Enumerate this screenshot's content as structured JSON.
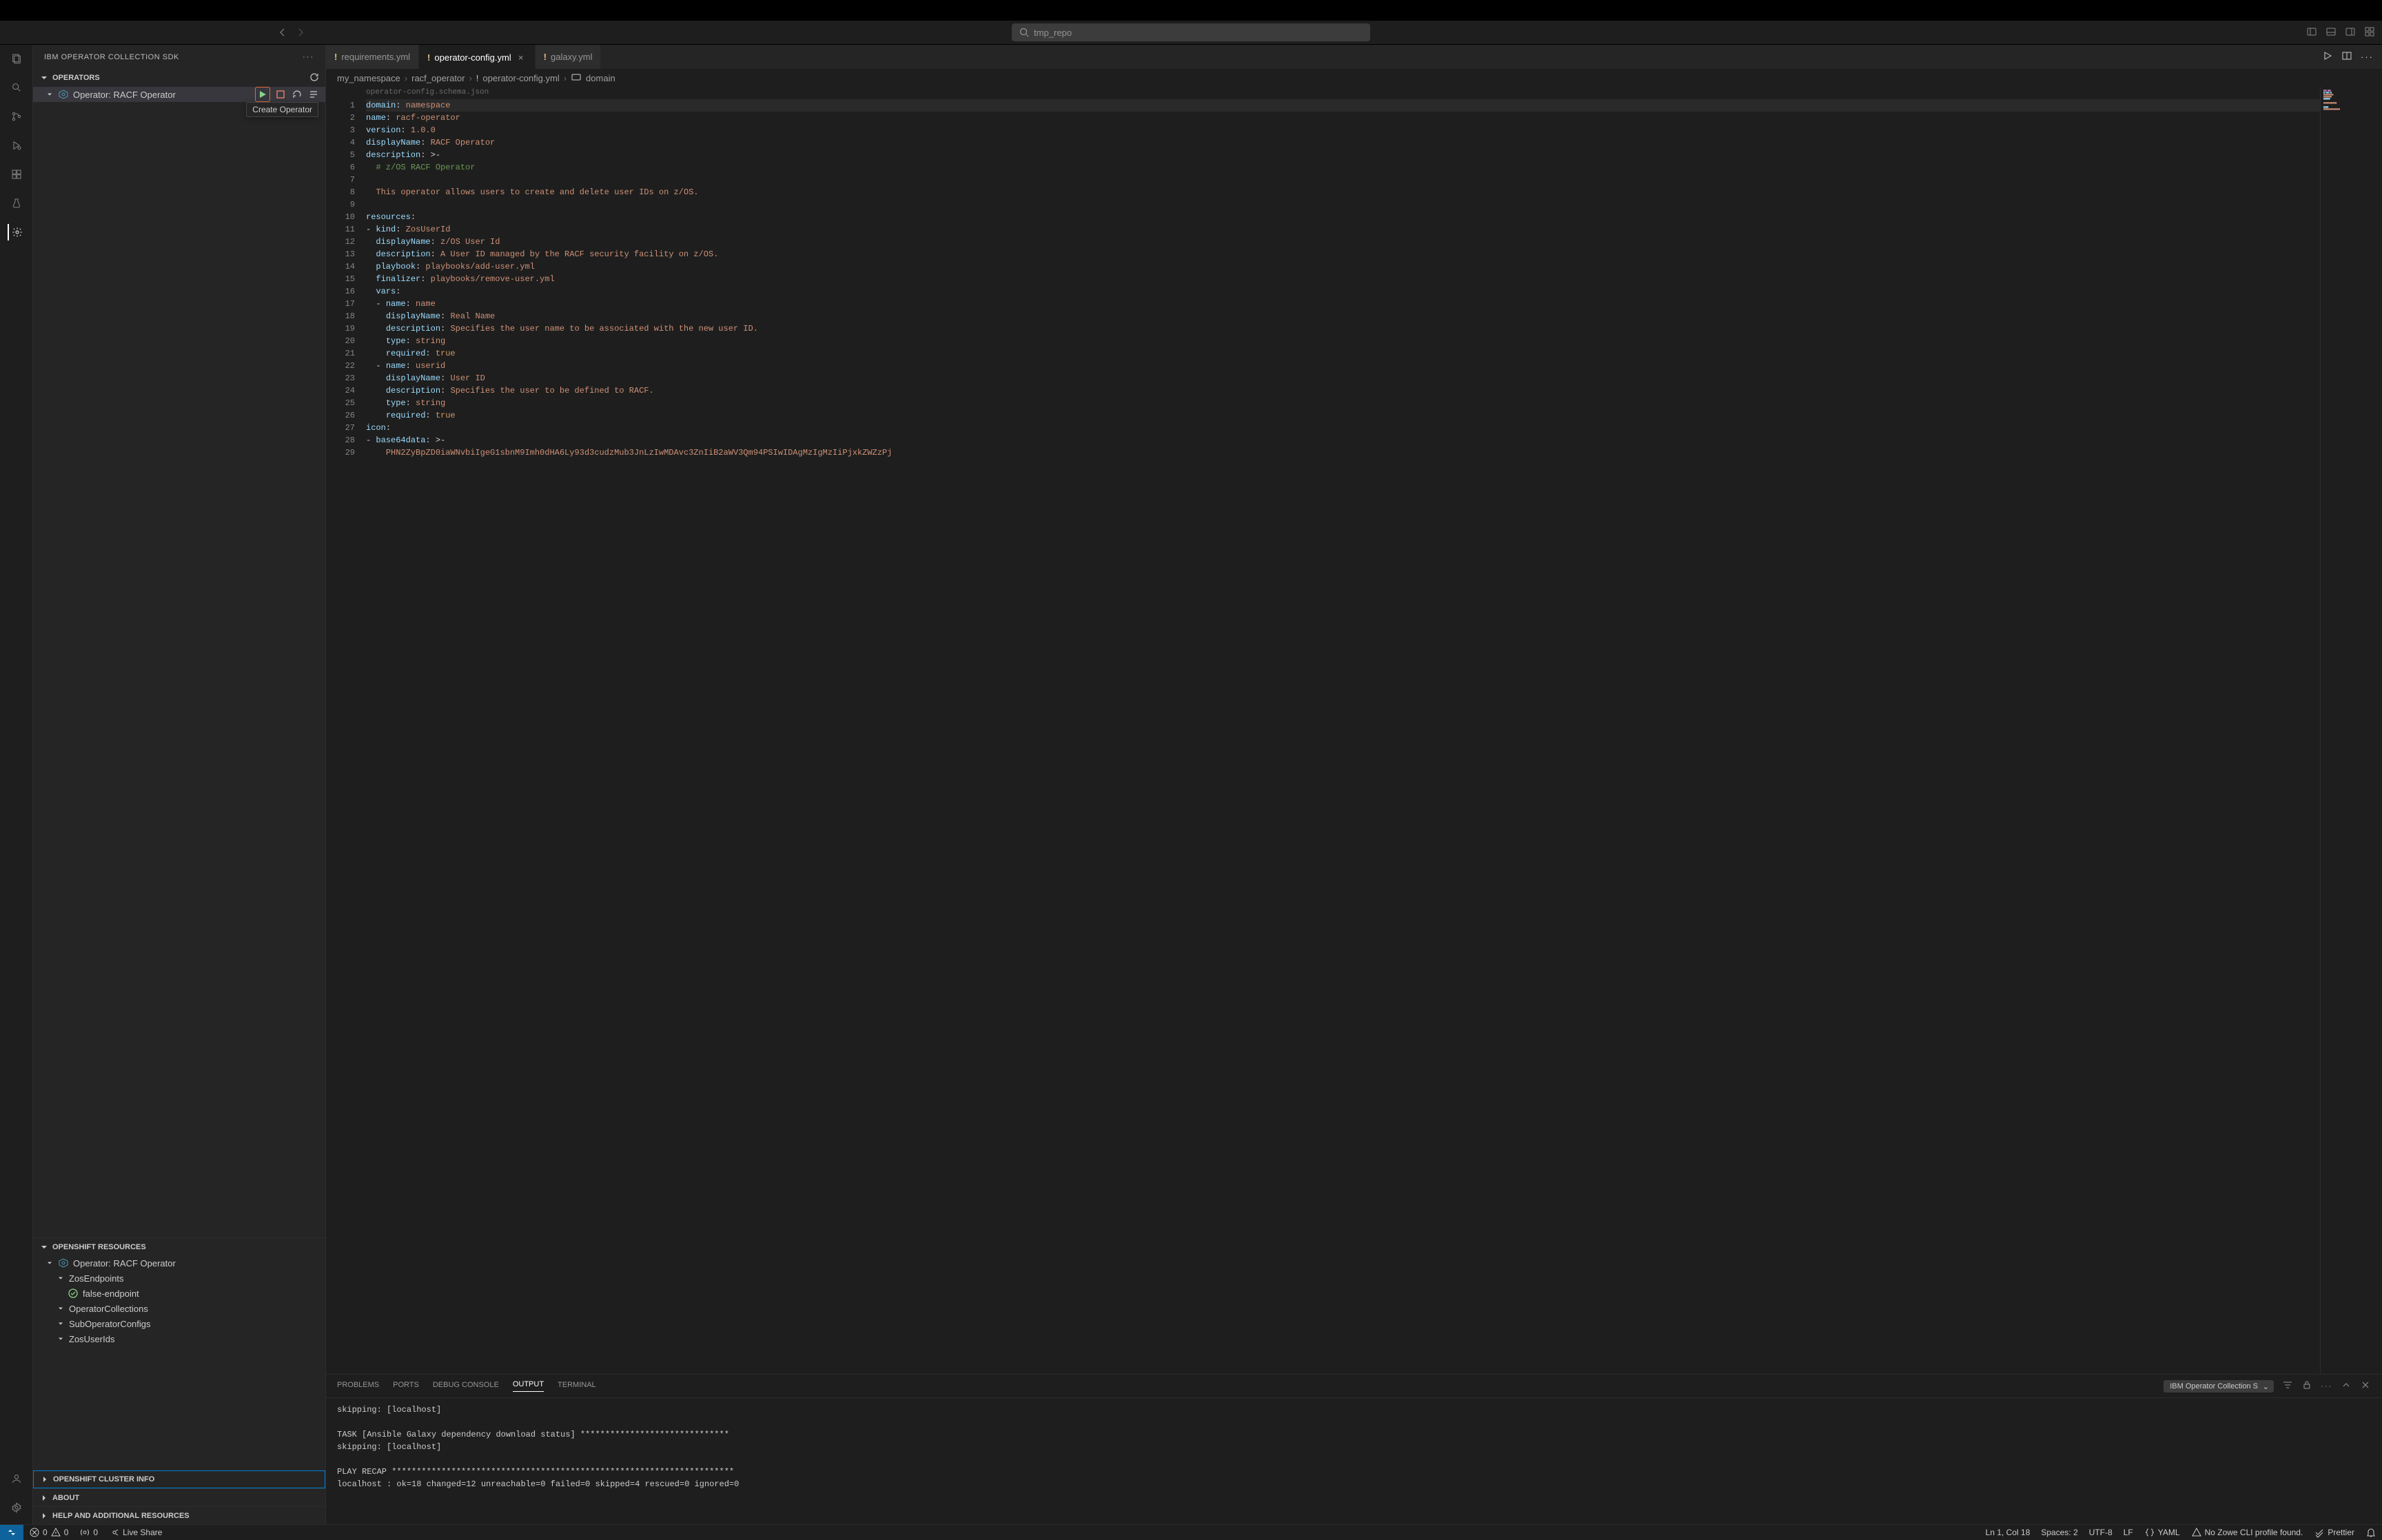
{
  "header": {
    "search_placeholder": "tmp_repo"
  },
  "sidebar": {
    "title": "IBM OPERATOR COLLECTION SDK",
    "sections": {
      "operators": {
        "label": "OPERATORS",
        "items": [
          {
            "label": "Operator: RACF Operator"
          }
        ],
        "hover_tooltip": "Create Operator"
      },
      "openshift_resources": {
        "label": "OPENSHIFT RESOURCES",
        "operator_label": "Operator: RACF Operator",
        "children": [
          {
            "label": "ZosEndpoints",
            "expanded": true,
            "children": [
              {
                "label": "false-endpoint",
                "status": "ok"
              }
            ]
          },
          {
            "label": "OperatorCollections"
          },
          {
            "label": "SubOperatorConfigs"
          },
          {
            "label": "ZosUserIds"
          }
        ]
      },
      "cluster_info": {
        "label": "OPENSHIFT CLUSTER INFO"
      },
      "about": {
        "label": "ABOUT"
      },
      "help": {
        "label": "HELP AND ADDITIONAL RESOURCES"
      }
    }
  },
  "tabs": [
    {
      "label": "requirements.yml",
      "active": false
    },
    {
      "label": "operator-config.yml",
      "active": true
    },
    {
      "label": "galaxy.yml",
      "active": false
    }
  ],
  "breadcrumb": [
    "my_namespace",
    "racf_operator",
    "operator-config.yml",
    "domain"
  ],
  "schema_hint": "operator-config.schema.json",
  "code_lines": [
    {
      "n": 1,
      "html": "<span class='k'>domain</span><span class='p'>:</span> <span class='s'>namespace</span>",
      "hl": true
    },
    {
      "n": 2,
      "html": "<span class='k'>name</span><span class='p'>:</span> <span class='s'>racf-operator</span>"
    },
    {
      "n": 3,
      "html": "<span class='k'>version</span><span class='p'>:</span> <span class='s'>1.0.0</span>"
    },
    {
      "n": 4,
      "html": "<span class='k'>displayName</span><span class='p'>:</span> <span class='s'>RACF Operator</span>"
    },
    {
      "n": 5,
      "html": "<span class='k'>description</span><span class='p'>:</span> <span class='p'>&gt;-</span>"
    },
    {
      "n": 6,
      "html": "  <span class='c'># z/OS RACF Operator</span>"
    },
    {
      "n": 7,
      "html": ""
    },
    {
      "n": 8,
      "html": "  <span class='s'>This operator allows users to create and delete user IDs on z/OS.</span>"
    },
    {
      "n": 9,
      "html": ""
    },
    {
      "n": 10,
      "html": "<span class='k'>resources</span><span class='p'>:</span>"
    },
    {
      "n": 11,
      "html": "<span class='p'>-</span> <span class='k'>kind</span><span class='p'>:</span> <span class='s'>ZosUserId</span>"
    },
    {
      "n": 12,
      "html": "  <span class='k'>displayName</span><span class='p'>:</span> <span class='s'>z/OS User Id</span>"
    },
    {
      "n": 13,
      "html": "  <span class='k'>description</span><span class='p'>:</span> <span class='s'>A User ID managed by the RACF security facility on z/OS.</span>"
    },
    {
      "n": 14,
      "html": "  <span class='k'>playbook</span><span class='p'>:</span> <span class='s'>playbooks/add-user.yml</span>"
    },
    {
      "n": 15,
      "html": "  <span class='k'>finalizer</span><span class='p'>:</span> <span class='s'>playbooks/remove-user.yml</span>"
    },
    {
      "n": 16,
      "html": "  <span class='k'>vars</span><span class='p'>:</span>"
    },
    {
      "n": 17,
      "html": "  <span class='p'>-</span> <span class='k'>name</span><span class='p'>:</span> <span class='s'>name</span>"
    },
    {
      "n": 18,
      "html": "    <span class='k'>displayName</span><span class='p'>:</span> <span class='s'>Real Name</span>"
    },
    {
      "n": 19,
      "html": "    <span class='k'>description</span><span class='p'>:</span> <span class='s'>Specifies the user name to be associated with the new user ID.</span>"
    },
    {
      "n": 20,
      "html": "    <span class='k'>type</span><span class='p'>:</span> <span class='s'>string</span>"
    },
    {
      "n": 21,
      "html": "    <span class='k'>required</span><span class='p'>:</span> <span class='b'>true</span>"
    },
    {
      "n": 22,
      "html": "  <span class='p'>-</span> <span class='k'>name</span><span class='p'>:</span> <span class='s'>userid</span>"
    },
    {
      "n": 23,
      "html": "    <span class='k'>displayName</span><span class='p'>:</span> <span class='s'>User ID</span>"
    },
    {
      "n": 24,
      "html": "    <span class='k'>description</span><span class='p'>:</span> <span class='s'>Specifies the user to be defined to RACF.</span>"
    },
    {
      "n": 25,
      "html": "    <span class='k'>type</span><span class='p'>:</span> <span class='s'>string</span>"
    },
    {
      "n": 26,
      "html": "    <span class='k'>required</span><span class='p'>:</span> <span class='b'>true</span>"
    },
    {
      "n": 27,
      "html": "<span class='k'>icon</span><span class='p'>:</span>"
    },
    {
      "n": 28,
      "html": "<span class='p'>-</span> <span class='k'>base64data</span><span class='p'>:</span> <span class='p'>&gt;-</span>"
    },
    {
      "n": 29,
      "html": "    <span class='s'>PHN2ZyBpZD0iaWNvbiIgeG1sbnM9Imh0dHA6Ly93d3cudzMub3JnLzIwMDAvc3ZnIiB2aWV3Qm94PSIwIDAgMzIgMzIiPjxkZWZzPj</span>"
    }
  ],
  "panel": {
    "tabs": [
      "PROBLEMS",
      "PORTS",
      "DEBUG CONSOLE",
      "OUTPUT",
      "TERMINAL"
    ],
    "active_tab": "OUTPUT",
    "selector": "IBM Operator Collection S",
    "lines": [
      "skipping: [localhost]",
      "",
      "TASK [Ansible Galaxy dependency download status] ******************************",
      "skipping: [localhost]",
      "",
      "PLAY RECAP *********************************************************************",
      "localhost                  : ok=18   changed=12   unreachable=0    failed=0    skipped=4    rescued=0    ignored=0"
    ]
  },
  "statusbar": {
    "errors": "0",
    "warnings": "0",
    "ports": "0",
    "live_share": "Live Share",
    "cursor": "Ln 1, Col 18",
    "spaces": "Spaces: 2",
    "encoding": "UTF-8",
    "eol": "LF",
    "lang": "YAML",
    "zowe": "No Zowe CLI profile found.",
    "prettier": "Prettier"
  }
}
